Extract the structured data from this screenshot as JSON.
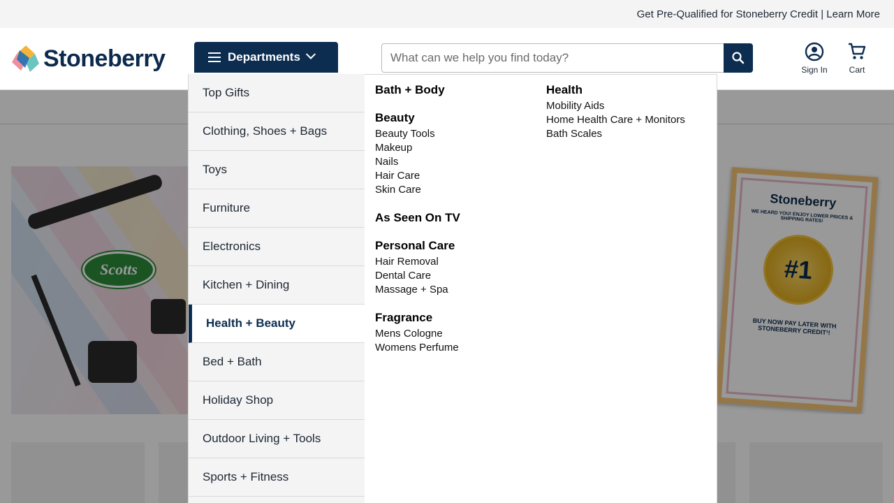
{
  "promo": {
    "text": "Get Pre-Qualified for Stoneberry Credit",
    "separator": " | ",
    "link": "Learn More"
  },
  "header": {
    "logo_text": "Stoneberry",
    "departments_label": "Departments",
    "search_placeholder": "What can we help you find today?",
    "signin_label": "Sign In",
    "cart_label": "Cart"
  },
  "colors": {
    "brand_navy": "#0c2d50",
    "menu_bg": "#f4f4f4",
    "overlay": "rgba(0,0,0,0.4)"
  },
  "hero": {
    "brand_badge": "Scotts",
    "card_logo": "Stoneberry",
    "card_line1": "WE HEARD YOU! ENJOY LOWER PRICES & SHIPPING RATES!",
    "card_medal": "#1",
    "card_line2": "BUY NOW PAY LATER WITH STONEBERRY CREDIT¹!"
  },
  "departments": [
    {
      "label": "Top Gifts",
      "active": false
    },
    {
      "label": "Clothing, Shoes + Bags",
      "active": false
    },
    {
      "label": "Toys",
      "active": false
    },
    {
      "label": "Furniture",
      "active": false
    },
    {
      "label": "Electronics",
      "active": false
    },
    {
      "label": "Kitchen + Dining",
      "active": false
    },
    {
      "label": "Health + Beauty",
      "active": true
    },
    {
      "label": "Bed + Bath",
      "active": false
    },
    {
      "label": "Holiday Shop",
      "active": false
    },
    {
      "label": "Outdoor Living + Tools",
      "active": false
    },
    {
      "label": "Sports + Fitness",
      "active": false
    }
  ],
  "submenu": {
    "col1": [
      {
        "title": "Bath + Body",
        "links": []
      },
      {
        "title": "Beauty",
        "links": [
          "Beauty Tools",
          "Makeup",
          "Nails",
          "Hair Care",
          "Skin Care"
        ]
      },
      {
        "title": "As Seen On TV",
        "links": []
      },
      {
        "title": "Personal Care",
        "links": [
          "Hair Removal",
          "Dental Care",
          "Massage + Spa"
        ]
      },
      {
        "title": "Fragrance",
        "links": [
          "Mens Cologne",
          "Womens Perfume"
        ]
      }
    ],
    "col2": [
      {
        "title": "Health",
        "links": [
          "Mobility Aids",
          "Home Health Care + Monitors",
          "Bath Scales"
        ]
      }
    ]
  }
}
